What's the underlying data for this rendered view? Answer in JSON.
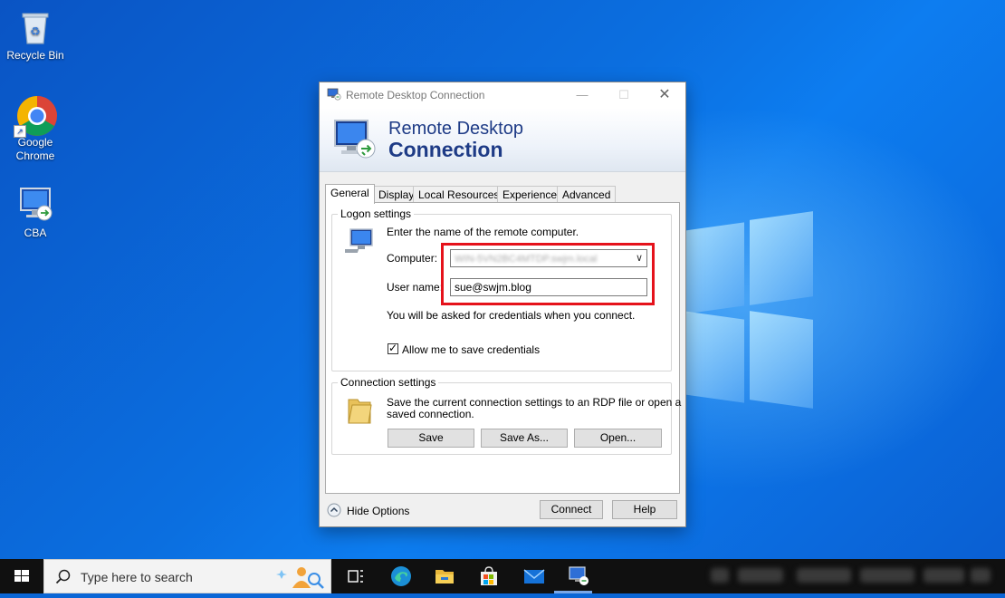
{
  "desktop": {
    "icons": [
      {
        "label": "Recycle Bin"
      },
      {
        "label": "Google\nChrome"
      },
      {
        "label": "CBA"
      }
    ]
  },
  "dialog": {
    "window_title": "Remote Desktop Connection",
    "banner_line1": "Remote Desktop",
    "banner_line2": "Connection",
    "tabs": [
      {
        "label": "General",
        "active": true
      },
      {
        "label": "Display"
      },
      {
        "label": "Local Resources"
      },
      {
        "label": "Experience"
      },
      {
        "label": "Advanced"
      }
    ],
    "logon": {
      "group_label": "Logon settings",
      "instruction": "Enter the name of the remote computer.",
      "computer_label": "Computer:",
      "computer_value": "WIN-5VN2BC4MTDP.swjm.local",
      "username_label": "User name:",
      "username_value": "sue@swjm.blog",
      "credentials_note": "You will be asked for credentials when you connect.",
      "save_credentials_label": "Allow me to save credentials",
      "save_credentials_checked": true
    },
    "connection": {
      "group_label": "Connection settings",
      "description_line1": "Save the current connection settings to an RDP file or open a",
      "description_line2": "saved connection.",
      "save_button": "Save",
      "save_as_button": "Save As...",
      "open_button": "Open..."
    },
    "footer": {
      "hide_options": "Hide Options",
      "connect_button": "Connect",
      "help_button": "Help"
    },
    "highlight_color": "#e5121b"
  },
  "taskbar": {
    "search_placeholder": "Type here to search"
  }
}
